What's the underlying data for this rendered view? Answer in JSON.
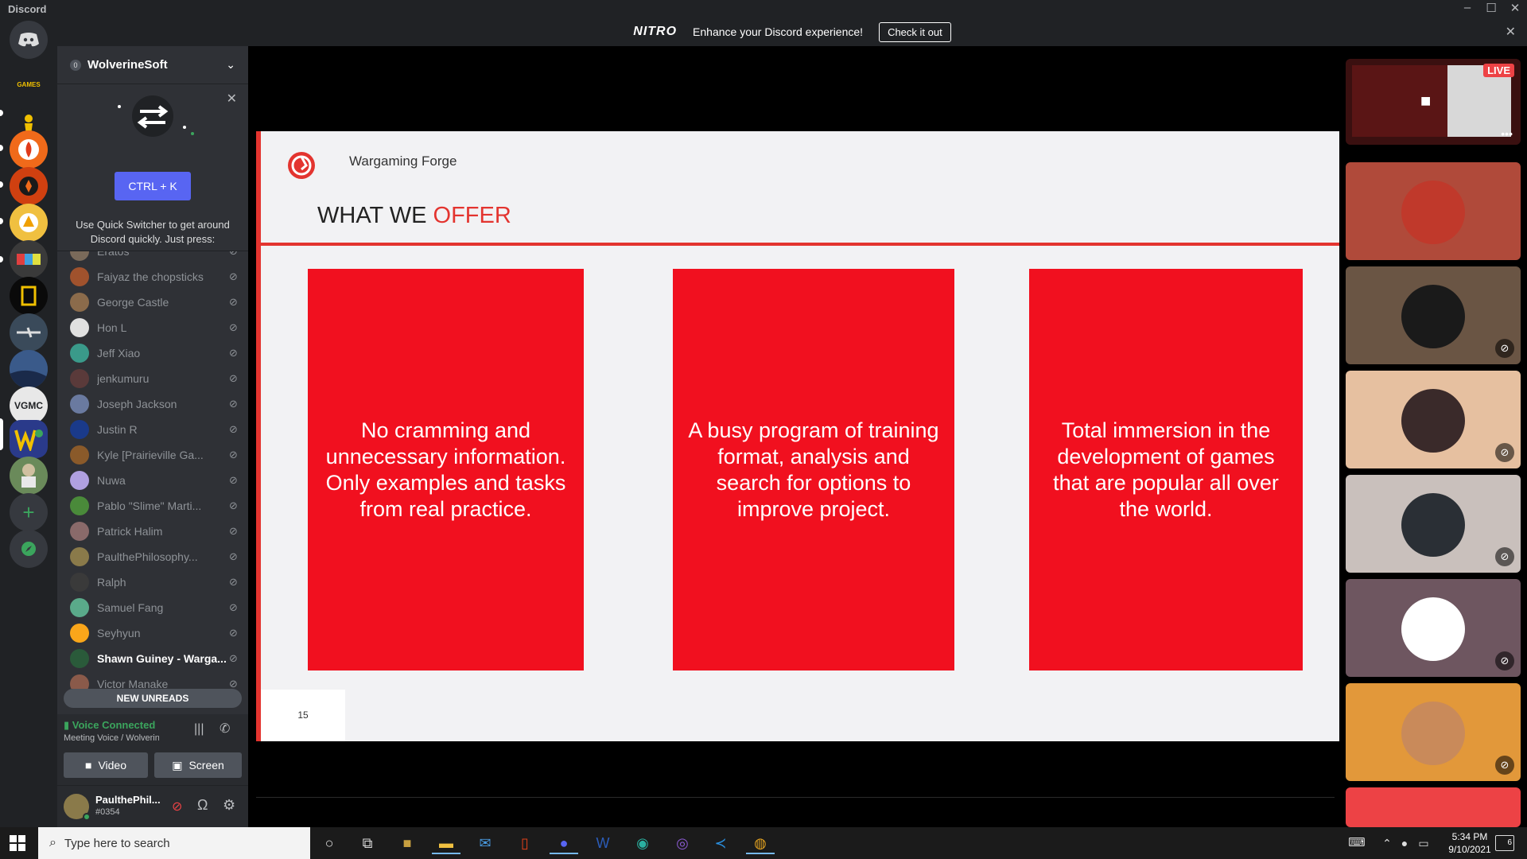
{
  "window": {
    "title": "Discord"
  },
  "banner": {
    "brand": "NITRO",
    "message": "Enhance your Discord experience!",
    "cta": "Check it out"
  },
  "server": {
    "name": "WolverineSoft",
    "boost_level": "0"
  },
  "quick_switcher": {
    "text": "Use Quick Switcher to get around Discord quickly. Just press:",
    "shortcut": "CTRL + K"
  },
  "members": [
    {
      "name": "Eratos",
      "color": "#7a6a5a"
    },
    {
      "name": "Faiyaz the chopsticks",
      "color": "#a0522d"
    },
    {
      "name": "George Castle",
      "color": "#8b6b4b"
    },
    {
      "name": "Hon L",
      "color": "#e0e0e0"
    },
    {
      "name": "Jeff Xiao",
      "color": "#3a9a8a"
    },
    {
      "name": "jenkumuru",
      "color": "#5a3a3a"
    },
    {
      "name": "Joseph Jackson",
      "color": "#6a7aa0"
    },
    {
      "name": "Justin R",
      "color": "#1a3a8a"
    },
    {
      "name": "Kyle [Prairieville Ga...",
      "color": "#8a5a2a"
    },
    {
      "name": "Nuwa",
      "color": "#b0a0e0"
    },
    {
      "name": "Pablo \"Slime\" Marti...",
      "color": "#4a8a3a"
    },
    {
      "name": "Patrick Halim",
      "color": "#8a6a6a"
    },
    {
      "name": "PaulthePhilosophy...",
      "color": "#8a7a4a"
    },
    {
      "name": "Ralph",
      "color": "#3a3a3a"
    },
    {
      "name": "Samuel Fang",
      "color": "#5aaa8a"
    },
    {
      "name": "Seyhyun",
      "color": "#faa61a"
    },
    {
      "name": "Shawn Guiney - Warga...",
      "color": "#2a5a3a"
    },
    {
      "name": "Victor Manake",
      "color": "#8a5a4a"
    }
  ],
  "unreads": "NEW UNREADS",
  "voice": {
    "status": "Voice Connected",
    "channel": "Meeting Voice / Wolverine...",
    "video": "Video",
    "screen": "Screen"
  },
  "user": {
    "name": "PaulthePhil...",
    "tag": "#0354"
  },
  "slide": {
    "company": "Wargaming Forge",
    "heading_a": "WHAT WE ",
    "heading_b": "OFFER",
    "cards": [
      "No cramming and unnecessary information. Only examples and tasks from real practice.",
      "A busy program of training format, analysis and search for options to improve project.",
      "Total immersion in the development of games that are popular all over the world."
    ],
    "page": "15"
  },
  "live_badge": "LIVE",
  "tiles": [
    {
      "bg": "#b04a3a",
      "face": "#c0392b"
    },
    {
      "bg": "#6a5544",
      "face": "#1a1a1a"
    },
    {
      "bg": "#e6c0a0",
      "face": "#3a2a2a"
    },
    {
      "bg": "#c9c0bc",
      "face": "#2a2f35"
    },
    {
      "bg": "#6e5660",
      "face": "#ffffff"
    },
    {
      "bg": "#e2983a",
      "face": "#c98a5a"
    }
  ],
  "taskbar": {
    "search_placeholder": "Type here to search",
    "time": "5:34 PM",
    "date": "9/10/2021",
    "notif": "6"
  }
}
